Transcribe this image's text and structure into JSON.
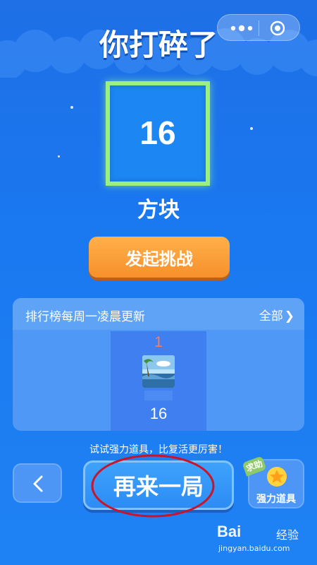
{
  "capsule": {
    "more_icon": "more-dots-icon",
    "close_icon": "target-circle-icon"
  },
  "result": {
    "title": "你打碎了",
    "count": "16",
    "unit": "方块"
  },
  "challenge_button": "发起挑战",
  "leaderboard": {
    "title": "排行榜每周一凌晨更新",
    "all_link": "全部",
    "entries": [
      {
        "rank": "1",
        "score": "16"
      }
    ]
  },
  "hint": "试试强力道具，比复活更厉害！",
  "actions": {
    "back_icon": "chevron-left-icon",
    "again_label": "再来一局",
    "power_label": "强力道具",
    "help_tag": "求助"
  },
  "watermark": {
    "brand": "Bai",
    "brand2": "经验",
    "url": "jingyan.baidu.com"
  },
  "colors": {
    "background": "#1a78f0",
    "block_border": "#9cf07e",
    "challenge": "#f7902b",
    "rank_number": "#ff7a55"
  }
}
